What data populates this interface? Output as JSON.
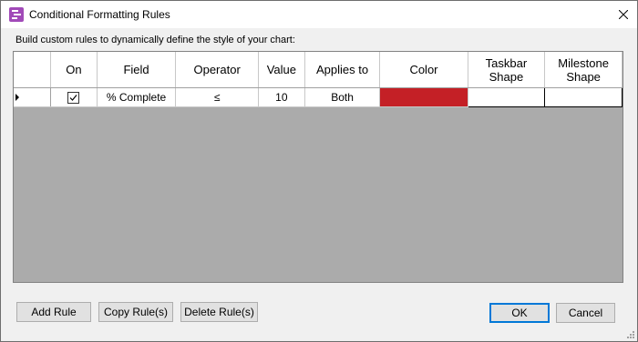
{
  "window": {
    "title": "Conditional Formatting Rules",
    "description": "Build custom rules to dynamically define the style of your chart:"
  },
  "grid": {
    "columns": {
      "on": "On",
      "field": "Field",
      "operator": "Operator",
      "value": "Value",
      "applies_to": "Applies to",
      "color": "Color",
      "taskbar_shape_1": "Taskbar",
      "taskbar_shape_2": "Shape",
      "milestone_shape_1": "Milestone",
      "milestone_shape_2": "Shape"
    },
    "rows": [
      {
        "on": true,
        "field": "% Complete",
        "operator": "≤",
        "value": "10",
        "applies_to": "Both",
        "color": "#c42026",
        "taskbar_shape": "",
        "milestone_shape": ""
      }
    ]
  },
  "buttons": {
    "add_rule": "Add Rule",
    "copy_rules": "Copy Rule(s)",
    "delete_rules": "Delete Rule(s)",
    "ok": "OK",
    "cancel": "Cancel"
  },
  "colors": {
    "grid_background": "#ababab",
    "accent": "#0078d7",
    "app_icon": "#a14ab8"
  }
}
